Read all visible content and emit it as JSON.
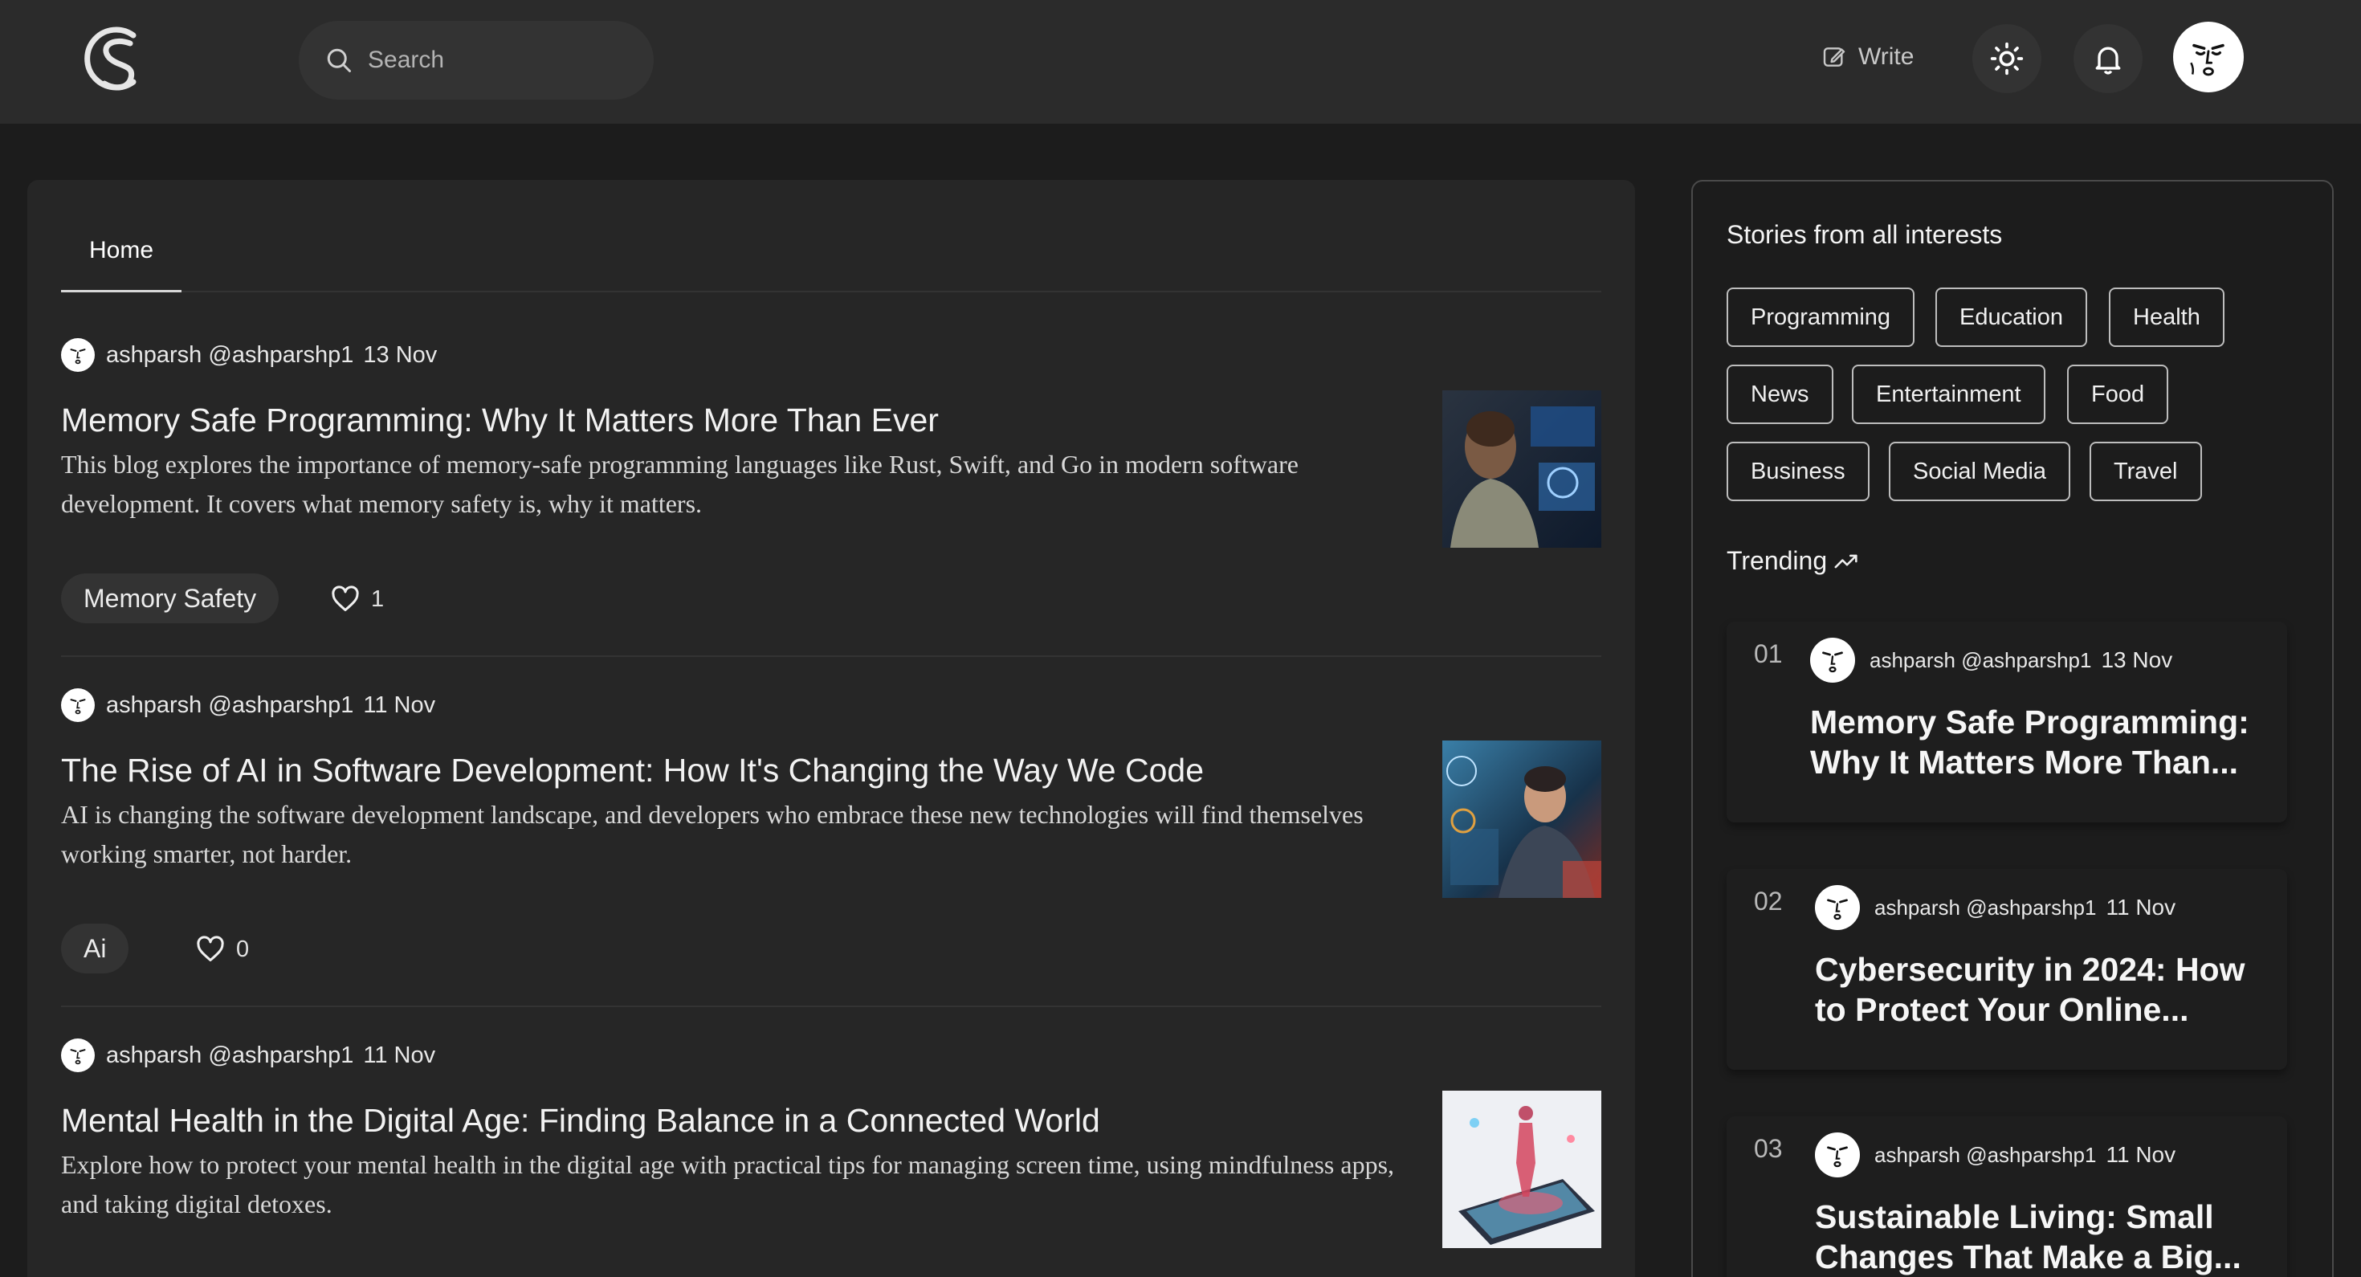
{
  "header": {
    "search_placeholder": "Search",
    "write_label": "Write",
    "icons": [
      "logo-icon",
      "search-icon",
      "edit-icon",
      "sun-icon",
      "bell-icon",
      "avatar"
    ]
  },
  "tabs": {
    "home": "Home"
  },
  "posts": [
    {
      "author": "ashparsh",
      "handle": "@ashparshp1",
      "date": "13 Nov",
      "title": "Memory Safe Programming: Why It Matters More Than Ever",
      "excerpt": "This blog explores the importance of memory-safe programming languages like Rust, Swift, and Go in modern software development. It covers what memory safety is, why it matters.",
      "tag": "Memory Safety",
      "likes": "1"
    },
    {
      "author": "ashparsh",
      "handle": "@ashparshp1",
      "date": "11 Nov",
      "title": "The Rise of AI in Software Development: How It's Changing the Way We Code",
      "excerpt": "AI is changing the software development landscape, and developers who embrace these new technologies will find themselves working smarter, not harder.",
      "tag": "Ai",
      "likes": "0"
    },
    {
      "author": "ashparsh",
      "handle": "@ashparshp1",
      "date": "11 Nov",
      "title": "Mental Health in the Digital Age: Finding Balance in a Connected World",
      "excerpt": "Explore how to protect your mental health in the digital age with practical tips for managing screen time, using mindfulness apps, and taking digital detoxes."
    }
  ],
  "sidebar": {
    "heading": "Stories from all interests",
    "interests": [
      "Programming",
      "Education",
      "Health",
      "News",
      "Entertainment",
      "Food",
      "Business",
      "Social Media",
      "Travel"
    ],
    "trending_label": "Trending",
    "trending": [
      {
        "num": "01",
        "author": "ashparsh",
        "handle": "@ashparshp1",
        "date": "13 Nov",
        "title": "Memory Safe Programming: Why It Matters More Than..."
      },
      {
        "num": "02",
        "author": "ashparsh",
        "handle": "@ashparshp1",
        "date": "11 Nov",
        "title": "Cybersecurity in 2024: How to Protect Your Online..."
      },
      {
        "num": "03",
        "author": "ashparsh",
        "handle": "@ashparshp1",
        "date": "11 Nov",
        "title": "Sustainable Living: Small Changes That Make a Big..."
      }
    ]
  },
  "colors": {
    "background": "#1c1c1c",
    "header": "#2b2b2b",
    "card": "#262626",
    "pill": "#333333",
    "text": "#ececec"
  }
}
